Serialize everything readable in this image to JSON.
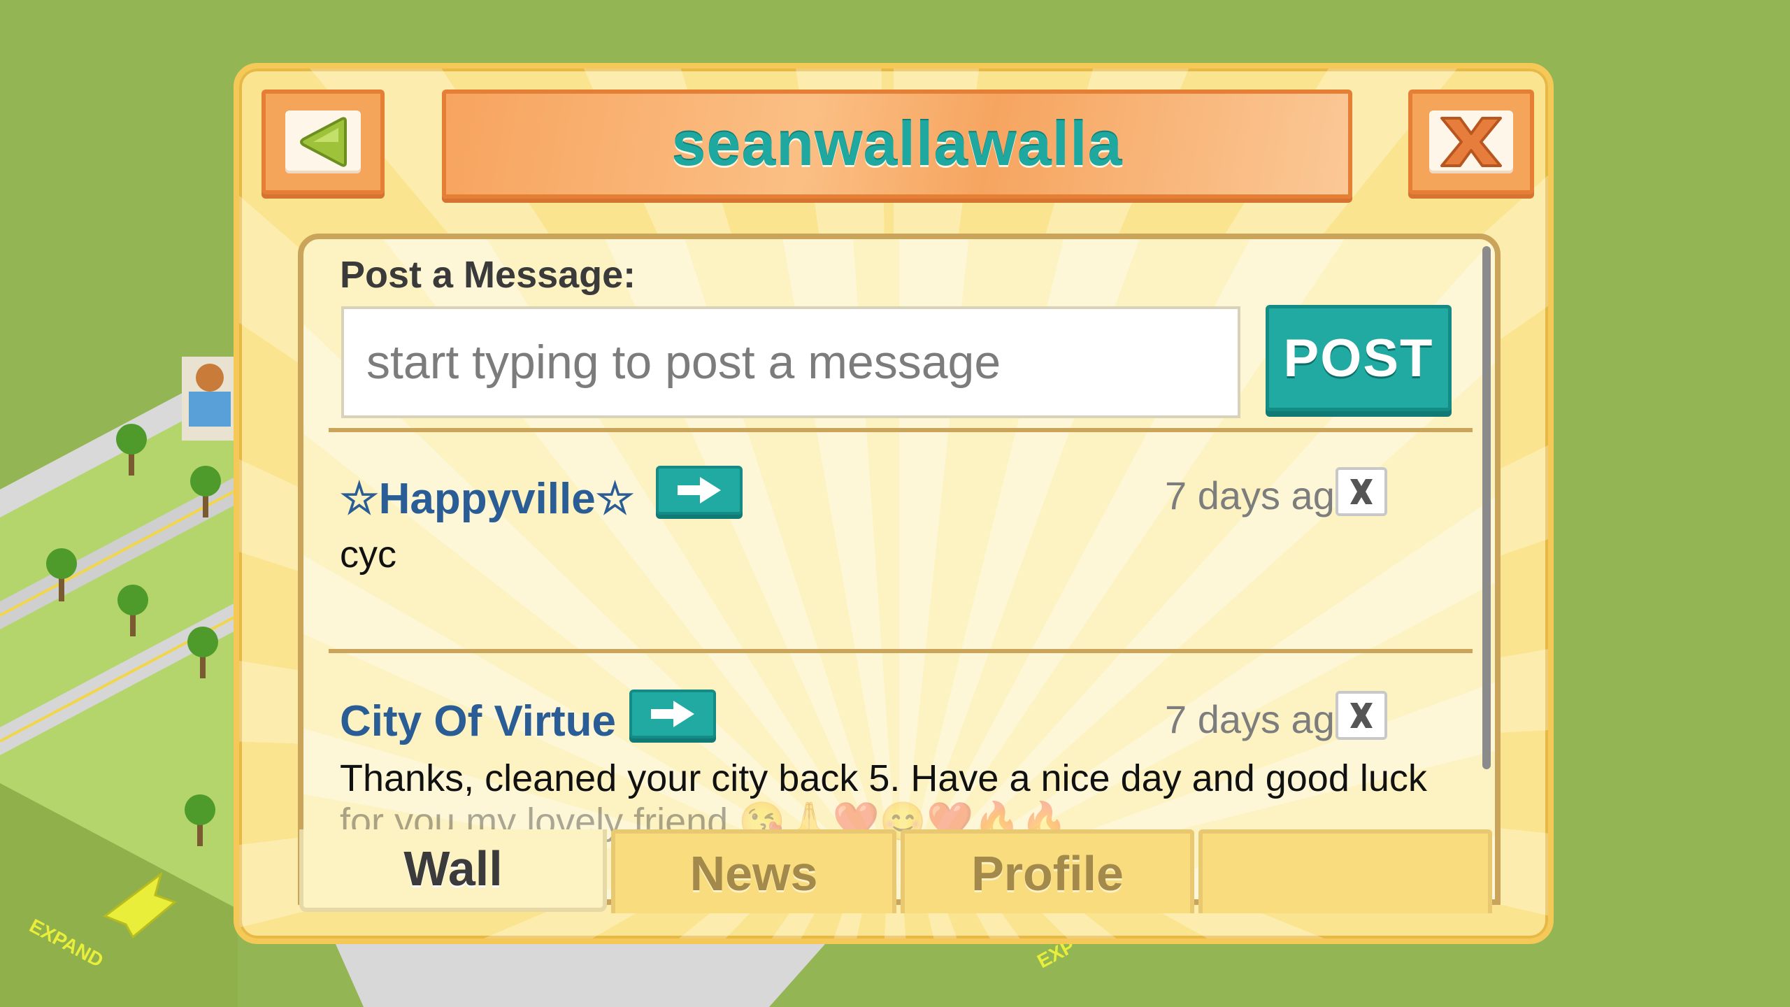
{
  "dialog": {
    "title": "seanwallawalla",
    "back_icon": "back-arrow-icon",
    "close_icon": "close-x-icon"
  },
  "composer": {
    "label": "Post a Message:",
    "placeholder": "start typing to post a message",
    "value": "",
    "post_label": "POST"
  },
  "wall": {
    "entries": [
      {
        "author": "☆Happyville☆",
        "time": "7 days ago",
        "message": "cyc"
      },
      {
        "author": "City Of Virtue",
        "time": "7 days ago",
        "message": "Thanks, cleaned your city back 5. Have a nice day and good luck",
        "message_cont": "for you my lovely friend 😘🙏❤️😊❤️🔥🔥"
      }
    ]
  },
  "tabs": [
    {
      "label": "Wall",
      "active": true
    },
    {
      "label": "News",
      "active": false
    },
    {
      "label": "Profile",
      "active": false
    },
    {
      "label": "",
      "active": false
    }
  ],
  "map": {
    "expand_label_left": "EXPAND",
    "expand_label_right": "EXP"
  },
  "colors": {
    "title_text": "#1ea8a0",
    "accent_teal": "#21aaa2",
    "orange_frame": "#e57f35",
    "author_blue": "#2a5d95",
    "grass": "#93b553"
  }
}
